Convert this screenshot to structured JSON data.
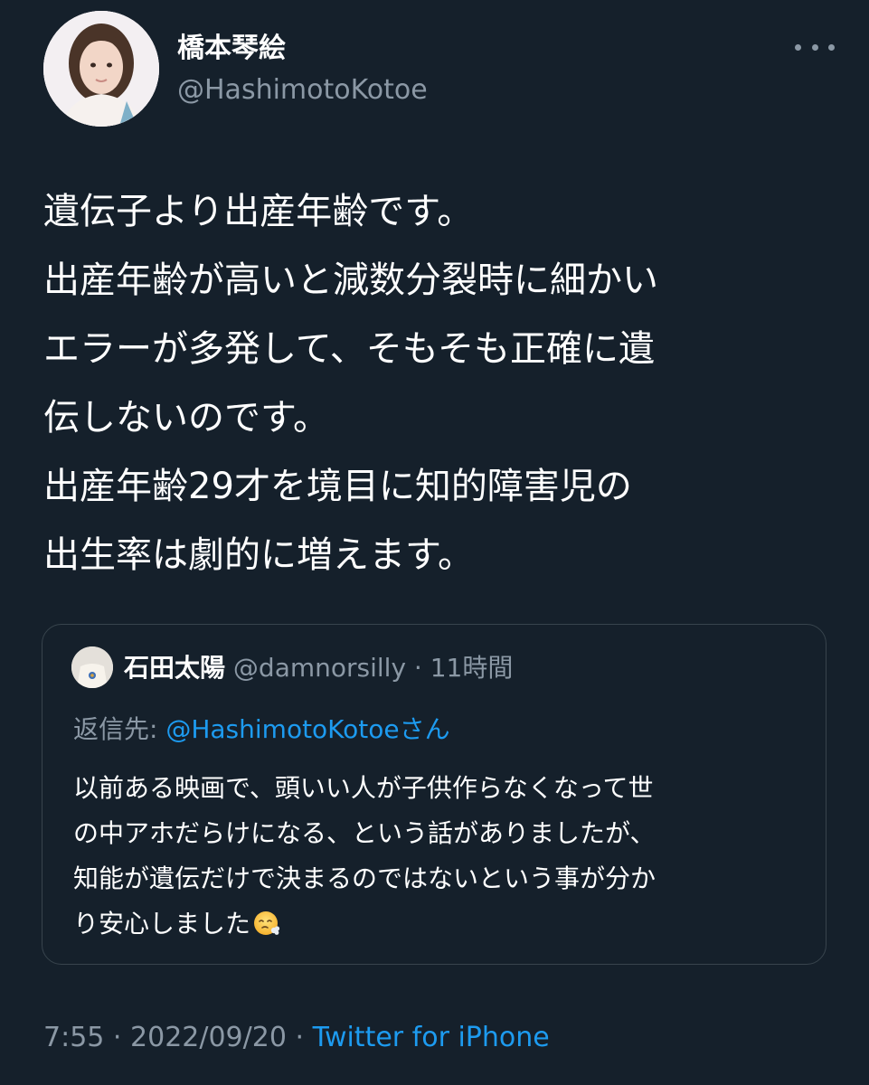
{
  "author": {
    "display_name": "橋本琴絵",
    "handle": "@HashimotoKotoe"
  },
  "tweet": {
    "lines": [
      "遺伝子より出産年齢です。",
      "出産年齢が高いと減数分裂時に細かい",
      "エラーが多発して、そもそも正確に遺",
      "伝しないのです。",
      "出産年齢29才を境目に知的障害児の",
      "出生率は劇的に増えます。"
    ]
  },
  "quoted_tweet": {
    "display_name": "石田太陽",
    "handle": "@damnorsilly",
    "separator": "·",
    "time": "11時間",
    "reply_prefix": "返信先:",
    "reply_handle": "@HashimotoKotoe",
    "reply_suffix": "さん",
    "lines": [
      "以前ある映画で、頭いい人が子供作らなくなって世",
      "の中アホだらけになる、という話がありましたが、",
      "知能が遺伝だけで決まるのではないという事が分か",
      "り安心しました"
    ],
    "emoji": "face-exhaling"
  },
  "footer": {
    "time": "7:55",
    "separator": "·",
    "date": "2022/09/20",
    "source": "Twitter for iPhone"
  },
  "colors": {
    "background": "#15202b",
    "text": "#ffffff",
    "secondary": "#8b98a5",
    "accent": "#1d9bf0",
    "border": "#38444d"
  },
  "icons": [
    "more-icon",
    "avatar",
    "quote-avatar",
    "face-exhaling-emoji"
  ]
}
